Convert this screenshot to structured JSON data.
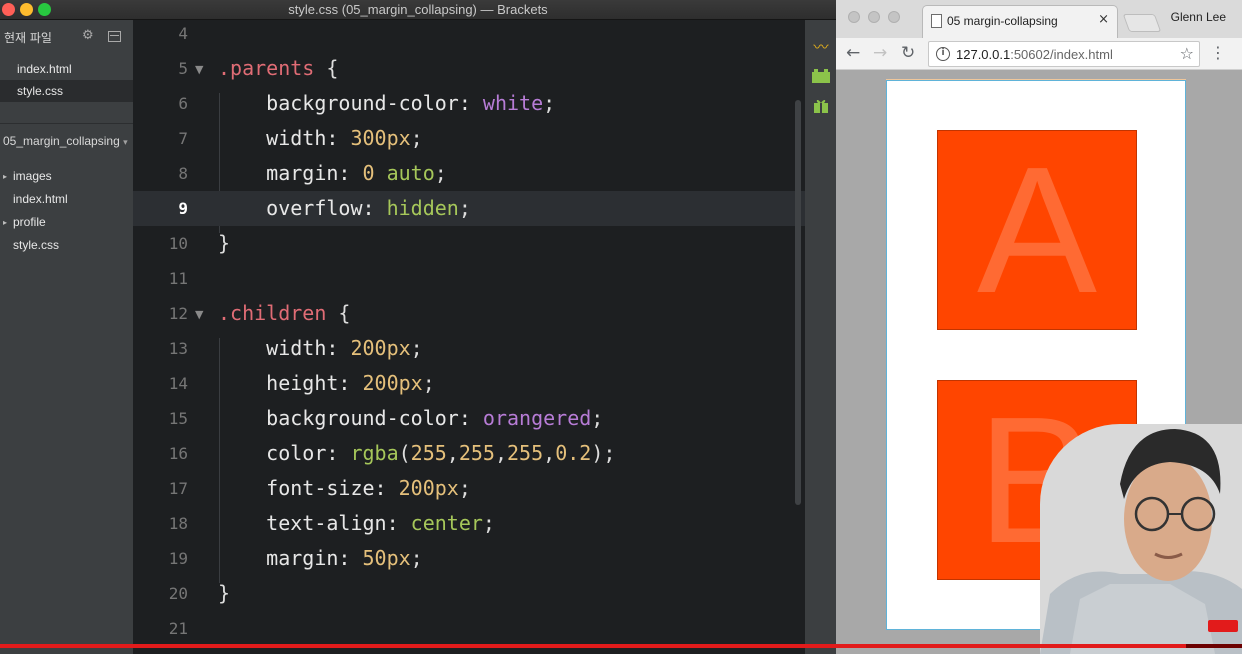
{
  "window_title": "style.css (05_margin_collapsing) — Brackets",
  "sidebar": {
    "header": "현재 파일",
    "working_files": [
      {
        "label": "index.html",
        "active": false
      },
      {
        "label": "style.css",
        "active": true
      }
    ],
    "project_name": "05_margin_collapsing",
    "tree": [
      {
        "label": "images",
        "folder": true
      },
      {
        "label": "index.html",
        "folder": false
      },
      {
        "label": "profile",
        "folder": true
      },
      {
        "label": "style.css",
        "folder": false
      }
    ]
  },
  "editor": {
    "current_line": 9,
    "lines": [
      {
        "n": "4",
        "tokens": []
      },
      {
        "n": "5",
        "fold": true,
        "tokens": [
          {
            "t": ".parents",
            "c": "sel"
          },
          {
            "t": " {",
            "c": "plain"
          }
        ]
      },
      {
        "n": "6",
        "tokens": [
          {
            "t": "    background-color: ",
            "c": "prop"
          },
          {
            "t": "white",
            "c": "kw"
          },
          {
            "t": ";",
            "c": "plain"
          }
        ]
      },
      {
        "n": "7",
        "tokens": [
          {
            "t": "    width: ",
            "c": "prop"
          },
          {
            "t": "300px",
            "c": "num"
          },
          {
            "t": ";",
            "c": "plain"
          }
        ]
      },
      {
        "n": "8",
        "tokens": [
          {
            "t": "    margin: ",
            "c": "prop"
          },
          {
            "t": "0",
            "c": "num"
          },
          {
            "t": " ",
            "c": "plain"
          },
          {
            "t": "auto",
            "c": "val"
          },
          {
            "t": ";",
            "c": "plain"
          }
        ]
      },
      {
        "n": "9",
        "tokens": [
          {
            "t": "    overflow: ",
            "c": "prop"
          },
          {
            "t": "hidden",
            "c": "val"
          },
          {
            "t": ";",
            "c": "plain"
          }
        ]
      },
      {
        "n": "10",
        "tokens": [
          {
            "t": "}",
            "c": "plain"
          }
        ]
      },
      {
        "n": "11",
        "tokens": []
      },
      {
        "n": "12",
        "fold": true,
        "tokens": [
          {
            "t": ".children",
            "c": "sel"
          },
          {
            "t": " {",
            "c": "plain"
          }
        ]
      },
      {
        "n": "13",
        "tokens": [
          {
            "t": "    width: ",
            "c": "prop"
          },
          {
            "t": "200px",
            "c": "num"
          },
          {
            "t": ";",
            "c": "plain"
          }
        ]
      },
      {
        "n": "14",
        "tokens": [
          {
            "t": "    height: ",
            "c": "prop"
          },
          {
            "t": "200px",
            "c": "num"
          },
          {
            "t": ";",
            "c": "plain"
          }
        ]
      },
      {
        "n": "15",
        "tokens": [
          {
            "t": "    background-color: ",
            "c": "prop"
          },
          {
            "t": "orangered",
            "c": "kw"
          },
          {
            "t": ";",
            "c": "plain"
          }
        ]
      },
      {
        "n": "16",
        "tokens": [
          {
            "t": "    color: ",
            "c": "prop"
          },
          {
            "t": "rgba",
            "c": "fn"
          },
          {
            "t": "(",
            "c": "plain"
          },
          {
            "t": "255",
            "c": "num"
          },
          {
            "t": ",",
            "c": "plain"
          },
          {
            "t": "255",
            "c": "num"
          },
          {
            "t": ",",
            "c": "plain"
          },
          {
            "t": "255",
            "c": "num"
          },
          {
            "t": ",",
            "c": "plain"
          },
          {
            "t": "0.2",
            "c": "num"
          },
          {
            "t": ");",
            "c": "plain"
          }
        ]
      },
      {
        "n": "17",
        "tokens": [
          {
            "t": "    font-size: ",
            "c": "prop"
          },
          {
            "t": "200px",
            "c": "num"
          },
          {
            "t": ";",
            "c": "plain"
          }
        ]
      },
      {
        "n": "18",
        "tokens": [
          {
            "t": "    text-align: ",
            "c": "prop"
          },
          {
            "t": "center",
            "c": "val"
          },
          {
            "t": ";",
            "c": "plain"
          }
        ]
      },
      {
        "n": "19",
        "tokens": [
          {
            "t": "    margin: ",
            "c": "prop"
          },
          {
            "t": "50px",
            "c": "num"
          },
          {
            "t": ";",
            "c": "plain"
          }
        ]
      },
      {
        "n": "20",
        "tokens": [
          {
            "t": "}",
            "c": "plain"
          }
        ]
      },
      {
        "n": "21",
        "tokens": []
      }
    ]
  },
  "toolstrip_icons": [
    "live-preview-icon",
    "extension-manager-icon",
    "gift-icon"
  ],
  "browser": {
    "tab_title": "05 margin-collapsing",
    "tab_close": "×",
    "user_name": "Glenn Lee",
    "url_host": "127.0.0.1",
    "url_rest": ":50602/index.html",
    "page": {
      "children": [
        "A",
        "B"
      ],
      "child_color": "#ff4500",
      "parent_border_color": "#5fb3d9"
    }
  },
  "video": {
    "progress_fraction": 0.955,
    "progress_color": "#e21b1b"
  },
  "colors": {
    "editor_bg": "#1d1f21",
    "current_line_bg": "#2c2f33",
    "selector": "#e06c75",
    "number": "#e5c07b",
    "keyword": "#b77cd6",
    "value": "#a6c75a"
  }
}
